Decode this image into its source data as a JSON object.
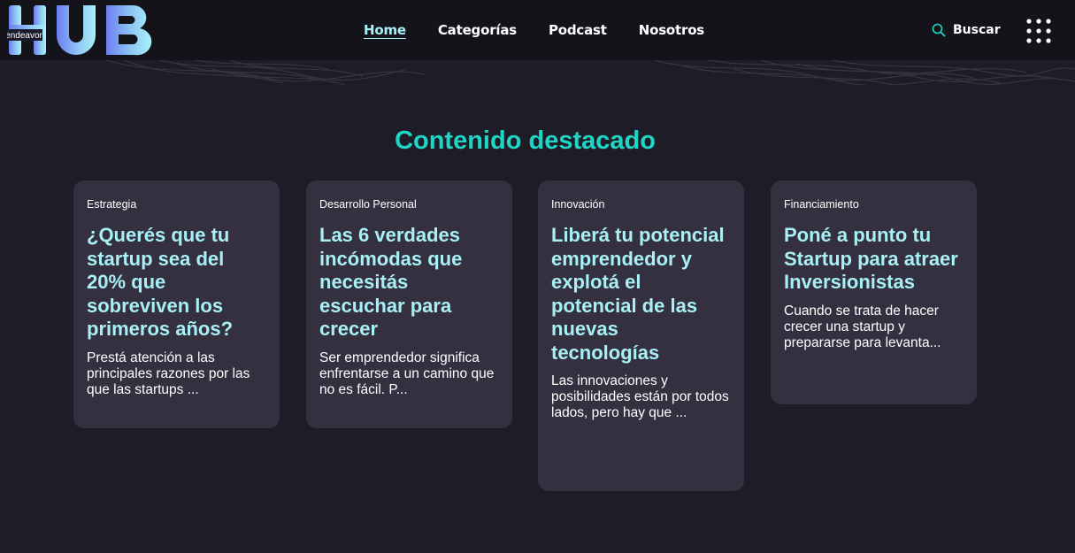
{
  "logo": {
    "small_text": "endeavor",
    "main_text": "HUB"
  },
  "nav": {
    "links": [
      {
        "label": "Home",
        "active": true
      },
      {
        "label": "Categorías",
        "active": false
      },
      {
        "label": "Podcast",
        "active": false
      },
      {
        "label": "Nosotros",
        "active": false
      }
    ],
    "search_label": "Buscar",
    "search_icon": "search-icon",
    "menu_icon": "grid-menu-icon"
  },
  "featured": {
    "title": "Contenido destacado",
    "cards": [
      {
        "category": "Estrategia",
        "title": "¿Querés que tu startup sea del 20% que sobreviven los primeros años?",
        "excerpt": "Prestá atención a las principales razones por las que las startups ..."
      },
      {
        "category": "Desarrollo Personal",
        "title": "Las 6 verdades incómodas que necesitás escuchar para crecer",
        "excerpt": "Ser emprendedor significa enfrentarse a un camino que no es fácil. P..."
      },
      {
        "category": "Innovación",
        "title": "Liberá tu potencial emprendedor y explotá el potencial de las nuevas tecnologías",
        "excerpt": "Las innovaciones y posibilidades están por todos lados, pero hay que ..."
      },
      {
        "category": "Financiamiento",
        "title": "Poné a punto tu Startup para atraer Inversionistas",
        "excerpt": "Cuando se trata de hacer crecer una startup y prepararse para levanta..."
      }
    ]
  },
  "colors": {
    "background": "#1e1c27",
    "navbar": "#141319",
    "card": "#343040",
    "accent_title": "#1fd6c6",
    "card_title": "#a8f0f4",
    "logo_gradient_start": "#6c7ef0",
    "logo_gradient_end": "#9ff2f7"
  }
}
